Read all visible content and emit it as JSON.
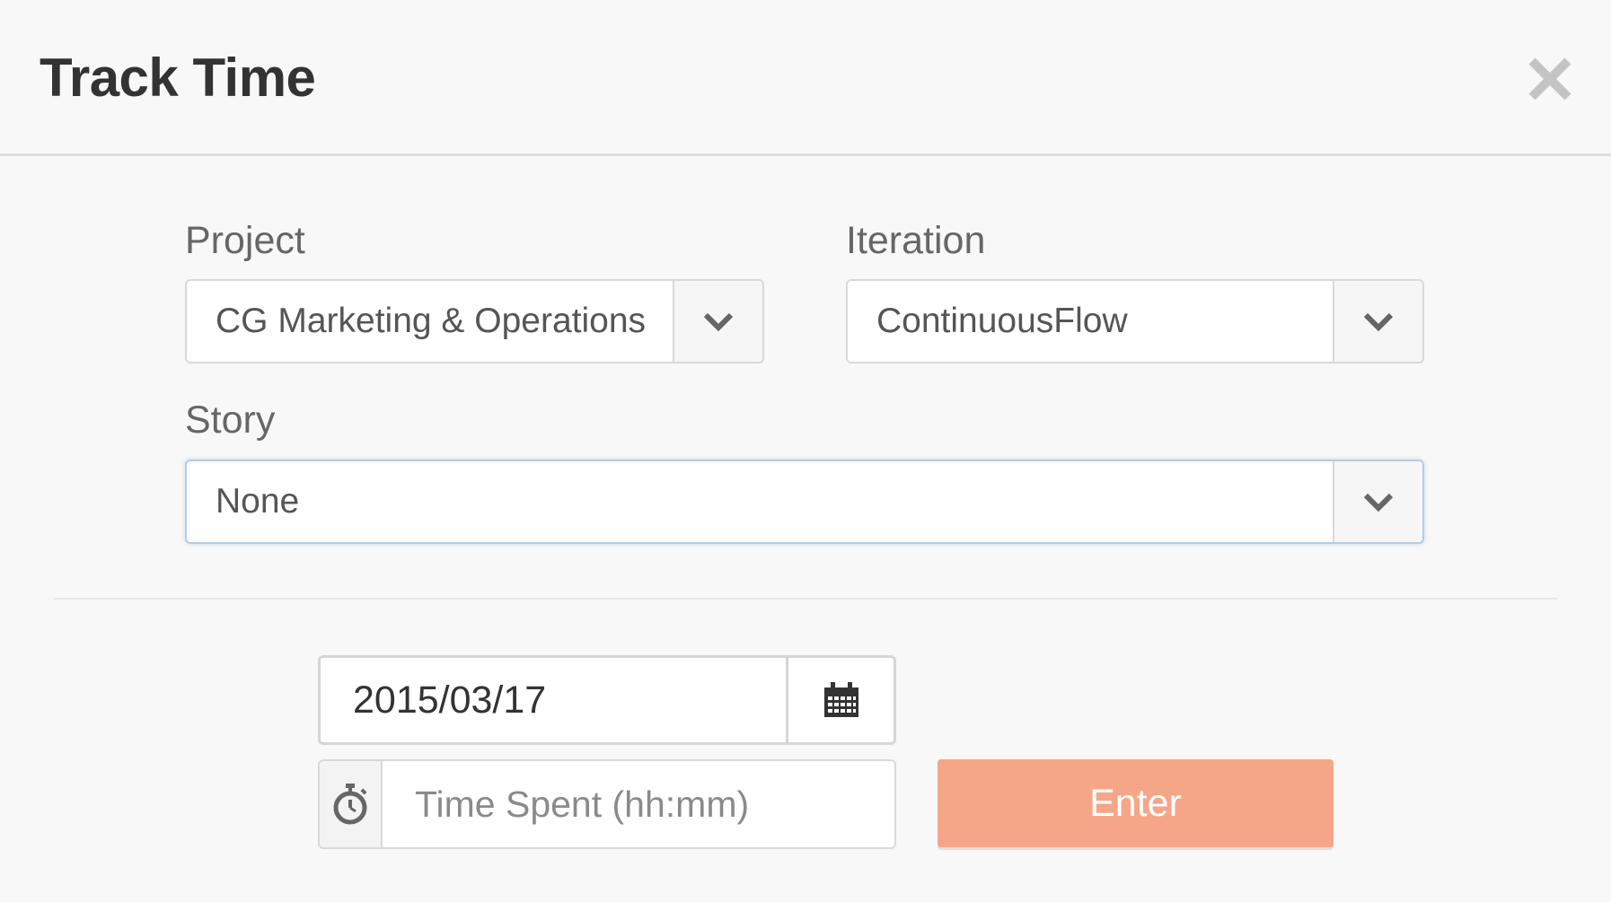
{
  "dialog": {
    "title": "Track Time",
    "close_icon": "close-icon"
  },
  "project": {
    "label": "Project",
    "value": "CG Marketing & Operations"
  },
  "iteration": {
    "label": "Iteration",
    "value": "ContinuousFlow"
  },
  "story": {
    "label": "Story",
    "value": "None"
  },
  "date": {
    "value": "2015/03/17",
    "icon": "calendar-icon"
  },
  "time_spent": {
    "placeholder": "Time Spent (hh:mm)",
    "icon": "stopwatch-icon"
  },
  "submit": {
    "label": "Enter",
    "color": "#f6a688"
  }
}
